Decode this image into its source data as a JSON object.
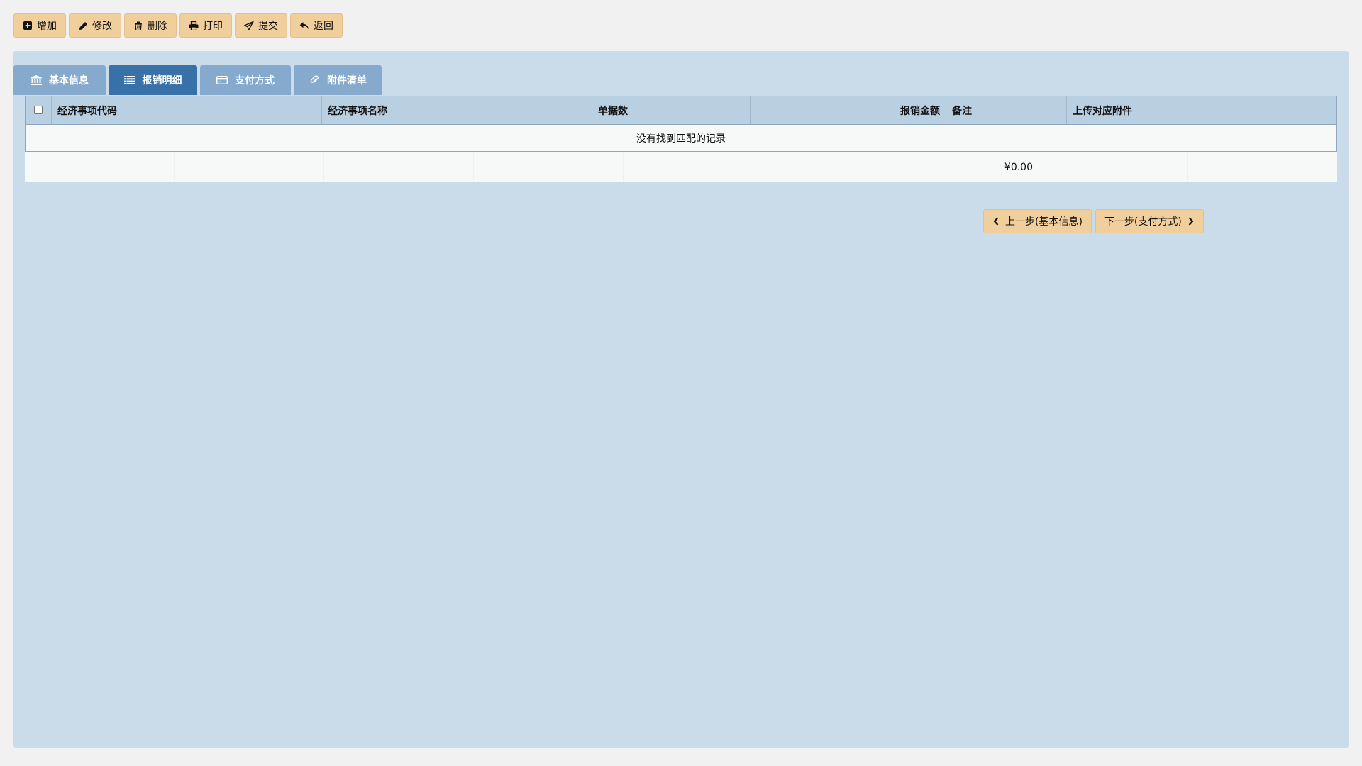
{
  "toolbar": {
    "buttons": [
      {
        "label": "增加",
        "icon": "plus-square-icon"
      },
      {
        "label": "修改",
        "icon": "pencil-icon"
      },
      {
        "label": "删除",
        "icon": "trash-icon"
      },
      {
        "label": "打印",
        "icon": "print-icon"
      },
      {
        "label": "提交",
        "icon": "send-icon"
      },
      {
        "label": "返回",
        "icon": "reply-icon"
      }
    ]
  },
  "tabs": [
    {
      "label": "基本信息",
      "icon": "bank-icon",
      "active": false
    },
    {
      "label": "报销明细",
      "icon": "list-icon",
      "active": true
    },
    {
      "label": "支付方式",
      "icon": "credit-card-icon",
      "active": false
    },
    {
      "label": "附件清单",
      "icon": "paperclip-icon",
      "active": false
    }
  ],
  "table": {
    "columns": [
      "经济事项代码",
      "经济事项名称",
      "单据数",
      "报销金额",
      "备注",
      "上传对应附件"
    ],
    "empty_text": "没有找到匹配的记录",
    "footer_total": "¥0.00"
  },
  "nav": {
    "prev_label": "上一步(基本信息)",
    "next_label": "下一步(支付方式)"
  },
  "colors": {
    "button_bg": "#f0cf9c",
    "panel_bg": "#cadcea",
    "tab_bg": "#86aacd",
    "tab_active_bg": "#3771a8",
    "header_bg": "#b9cfe2"
  }
}
